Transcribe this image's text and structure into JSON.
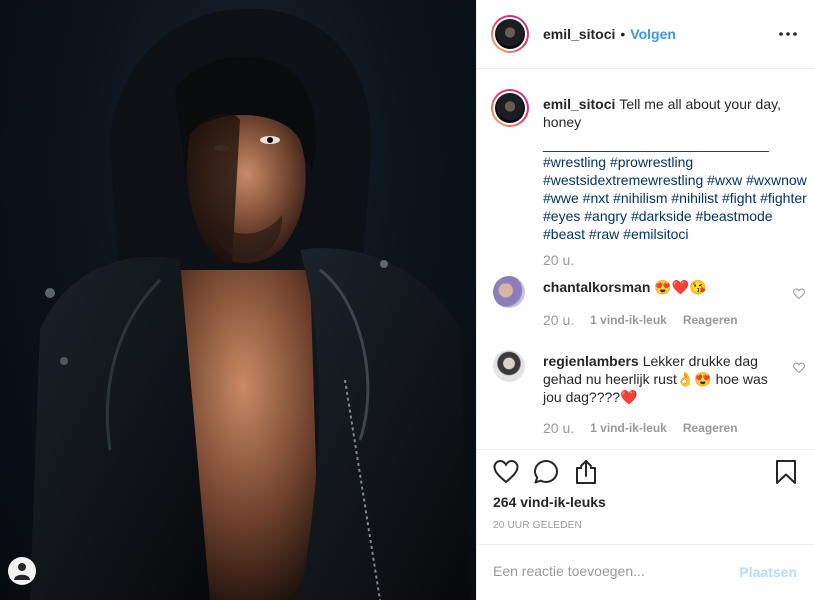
{
  "post": {
    "username": "emil_sitoci",
    "separator": "•",
    "follow_label": "Volgen",
    "caption": {
      "text": "Tell me all about your day, honey",
      "rule": "_____________________________",
      "hashtags": "#wrestling #prowrestling #westsidextremewrestling #wxw #wxwnow #wwe #nxt #nihilism #nihilist #fight #fighter #eyes #angry #darkside #beastmode #beast #raw #emilsitoci",
      "time": "20 u."
    },
    "comments": [
      {
        "username": "chantalkorsman",
        "text": "😍❤️😘",
        "time": "20 u.",
        "likes": "1 vind-ik-leuk",
        "reply": "Reageren"
      },
      {
        "username": "regienlambers",
        "text": "Lekker drukke dag gehad nu heerlijk rust👌😍 hoe was jou dag????❤️",
        "time": "20 u.",
        "likes": "1 vind-ik-leuk",
        "reply": "Reageren"
      }
    ],
    "likes": "264 vind-ik-leuks",
    "posted_ago": "20 UUR GELEDEN",
    "comment_input": {
      "placeholder": "Een reactie toevoegen...",
      "value": ""
    },
    "post_button": "Plaatsen"
  },
  "icons": {
    "more": "more-options-icon",
    "like": "heart-icon",
    "comment": "comment-icon",
    "share": "share-icon",
    "save": "bookmark-icon",
    "tag": "user-tag-icon"
  },
  "colors": {
    "link": "#3897f0",
    "hashtag": "#003569",
    "muted": "#999999",
    "post_disabled": "#b2dffc"
  }
}
